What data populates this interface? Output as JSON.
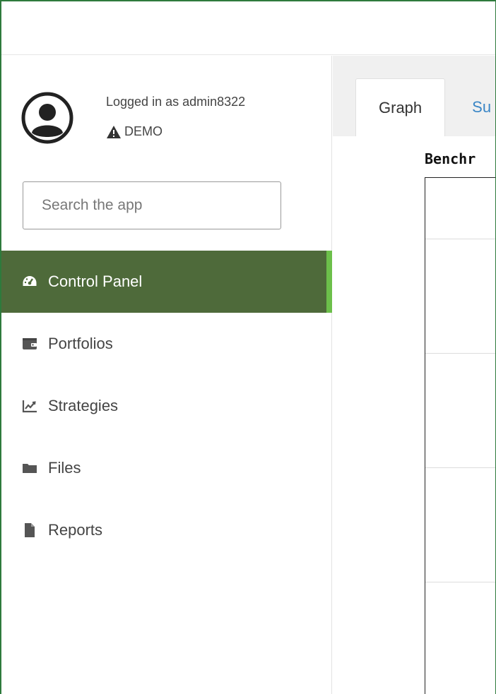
{
  "user": {
    "logged_in_text": "Logged in as admin8322",
    "mode_label": "DEMO",
    "avatar_icon": "user-circle-icon",
    "warning_icon": "warning-triangle-icon"
  },
  "search": {
    "placeholder": "Search the app",
    "value": ""
  },
  "sidebar": {
    "items": [
      {
        "label": "Control Panel",
        "icon": "dashboard-gauge-icon",
        "active": true
      },
      {
        "label": "Portfolios",
        "icon": "wallet-icon",
        "active": false
      },
      {
        "label": "Strategies",
        "icon": "line-chart-icon",
        "active": false
      },
      {
        "label": "Files",
        "icon": "folder-icon",
        "active": false
      },
      {
        "label": "Reports",
        "icon": "file-icon",
        "active": false
      }
    ]
  },
  "main": {
    "tabs": [
      {
        "label": "Graph",
        "active": true
      },
      {
        "label": "Su",
        "active": false
      }
    ],
    "chart_title": "Benchr"
  },
  "colors": {
    "frame_border": "#2e7a3c",
    "active_nav_bg": "#4e6a3a",
    "active_nav_accent": "#6cbf4a",
    "link_blue": "#3a86c6"
  }
}
